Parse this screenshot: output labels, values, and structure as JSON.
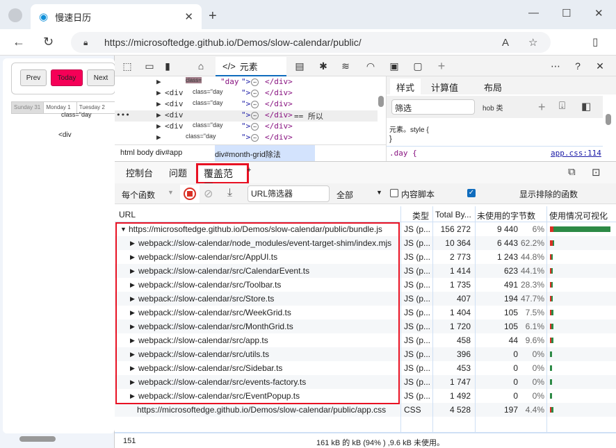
{
  "browser": {
    "tab_title": "慢速日历",
    "url": "https://microsoftedge.github.io/Demos/slow-calendar/public/"
  },
  "page": {
    "prev": "Prev",
    "today": "Today",
    "next": "Next",
    "days": [
      "Sunday 31",
      "Monday 1",
      "Tuesday 2"
    ],
    "overlay_class": "class=\"day",
    "overlay_div": "<div"
  },
  "devtools": {
    "elements_tab": "元素",
    "styles_tabs": [
      "样式",
      "计算值",
      "布局"
    ],
    "filter_placeholder": "筛选",
    "hov": "hob 类",
    "element_style": "元素。style {",
    "brace": "}",
    "rule_selector": ".day {",
    "rule_source": "app.css:114",
    "breadcrumb": [
      "html body div#app",
      "div#month-grid除法"
    ],
    "selected_eq": "== 所以",
    "dom": [
      {
        "tag": "",
        "cls": "class=",
        "val": "\"day"
      },
      {
        "tag": "<div",
        "cls": "class=\"day",
        "val": ""
      },
      {
        "tag": "<div",
        "cls": "class=\"day",
        "val": ""
      },
      {
        "tag": "<div",
        "cls": "",
        "val": ""
      },
      {
        "tag": "<div",
        "cls": "class=\"day",
        "val": ""
      },
      {
        "tag": "",
        "cls": "class=\"day",
        "val": ""
      }
    ],
    "close_div": "</div>",
    "dom_tail": "\">"
  },
  "drawer": {
    "tabs": [
      "控制台",
      "问题",
      "覆盖范围"
    ]
  },
  "coverage": {
    "mode": "每个函数",
    "url_filter": "URL筛选器",
    "type_filter": "全部",
    "content_scripts": "内容脚本",
    "show_excluded": "显示排除的函数",
    "headers": [
      "URL",
      "类型",
      "Total By...",
      "未使用的字节数",
      "使用情况可视化"
    ],
    "rows": [
      {
        "url": "https://microsoftedge.github.io/Demos/slow-calendar/public/bundle.js",
        "type": "JS (p...",
        "total": "156 272",
        "unused": "9 440",
        "pct": "6%",
        "t": 156272,
        "u": 9440,
        "level": 0
      },
      {
        "url": "webpack://slow-calendar/node_modules/event-target-shim/index.mjs",
        "type": "JS (p...",
        "total": "10 364",
        "unused": "6 443",
        "pct": "62.2%",
        "t": 10364,
        "u": 6443,
        "level": 1
      },
      {
        "url": "webpack://slow-calendar/src/AppUI.ts",
        "type": "JS (p...",
        "total": "2 773",
        "unused": "1 243",
        "pct": "44.8%",
        "t": 2773,
        "u": 1243,
        "level": 1
      },
      {
        "url": "webpack://slow-calendar/src/CalendarEvent.ts",
        "type": "JS (p...",
        "total": "1 414",
        "unused": "623",
        "pct": "44.1%",
        "t": 1414,
        "u": 623,
        "level": 1
      },
      {
        "url": "webpack://slow-calendar/src/Toolbar.ts",
        "type": "JS (p...",
        "total": "1 735",
        "unused": "491",
        "pct": "28.3%",
        "t": 1735,
        "u": 491,
        "level": 1
      },
      {
        "url": "webpack://slow-calendar/src/Store.ts",
        "type": "JS (p...",
        "total": "407",
        "unused": "194",
        "pct": "47.7%",
        "t": 407,
        "u": 194,
        "level": 1
      },
      {
        "url": "webpack://slow-calendar/src/WeekGrid.ts",
        "type": "JS (p...",
        "total": "1 404",
        "unused": "105",
        "pct": "7.5%",
        "t": 1404,
        "u": 105,
        "level": 1
      },
      {
        "url": "webpack://slow-calendar/src/MonthGrid.ts",
        "type": "JS (p...",
        "total": "1 720",
        "unused": "105",
        "pct": "6.1%",
        "t": 1720,
        "u": 105,
        "level": 1
      },
      {
        "url": "webpack://slow-calendar/src/app.ts",
        "type": "JS (p...",
        "total": "458",
        "unused": "44",
        "pct": "9.6%",
        "t": 458,
        "u": 44,
        "level": 1
      },
      {
        "url": "webpack://slow-calendar/src/utils.ts",
        "type": "JS (p...",
        "total": "396",
        "unused": "0",
        "pct": "0%",
        "t": 396,
        "u": 0,
        "level": 1
      },
      {
        "url": "webpack://slow-calendar/src/Sidebar.ts",
        "type": "JS (p...",
        "total": "453",
        "unused": "0",
        "pct": "0%",
        "t": 453,
        "u": 0,
        "level": 1
      },
      {
        "url": "webpack://slow-calendar/src/events-factory.ts",
        "type": "JS (p...",
        "total": "1 747",
        "unused": "0",
        "pct": "0%",
        "t": 1747,
        "u": 0,
        "level": 1
      },
      {
        "url": "webpack://slow-calendar/src/EventPopup.ts",
        "type": "JS (p...",
        "total": "1 492",
        "unused": "0",
        "pct": "0%",
        "t": 1492,
        "u": 0,
        "level": 1
      },
      {
        "url": "https://microsoftedge.github.io/Demos/slow-calendar/public/app.css",
        "type": "CSS",
        "total": "4 528",
        "unused": "197",
        "pct": "4.4%",
        "t": 4528,
        "u": 197,
        "level": -1
      }
    ],
    "footer_left": "151",
    "footer_summary": "161 kB 的 kB (94% ) ,9.6 kB 未使用。"
  },
  "colors": {
    "unused": "#d93025",
    "used": "#2d8a46",
    "highlight": "#e81123",
    "accent": "#0f6cbd",
    "today": "#f50057"
  }
}
